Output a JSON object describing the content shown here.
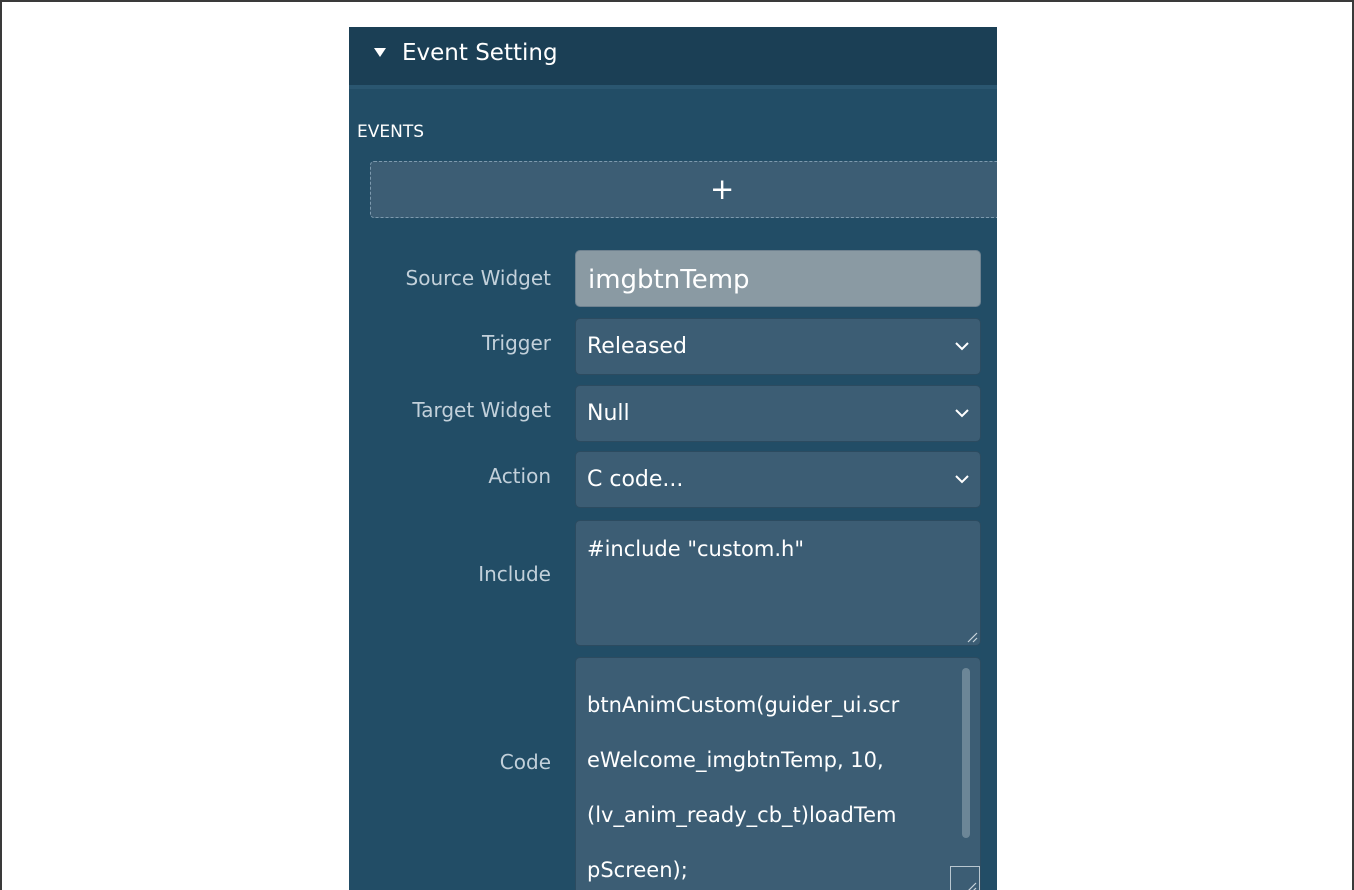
{
  "header": {
    "title": "Event Setting"
  },
  "events": {
    "section_label": "EVENTS",
    "add_symbol": "+"
  },
  "form": {
    "source_widget": {
      "label": "Source Widget",
      "value": "imgbtnTemp"
    },
    "trigger": {
      "label": "Trigger",
      "value": "Released"
    },
    "target_widget": {
      "label": "Target Widget",
      "value": "Null"
    },
    "action": {
      "label": "Action",
      "value": "C code..."
    },
    "include": {
      "label": "Include",
      "value": "#include \"custom.h\""
    },
    "code": {
      "label": "Code",
      "lines": [
        "btnAnimCustom(guider_ui.scr",
        "eWelcome_imgbtnTemp, 10,",
        "(lv_anim_ready_cb_t)loadTem",
        "pScreen);"
      ]
    }
  },
  "icons": {
    "collapse": "triangle-down-icon",
    "add": "plus-icon",
    "dropdown": "chevron-down-icon",
    "resize": "resize-grip-icon"
  },
  "colors": {
    "panel_bg": "#224d66",
    "header_bg": "#1b3f55",
    "field_bg": "#3c5d74",
    "readonly_bg": "#8a9aa3",
    "label_text": "#c2d0da"
  }
}
